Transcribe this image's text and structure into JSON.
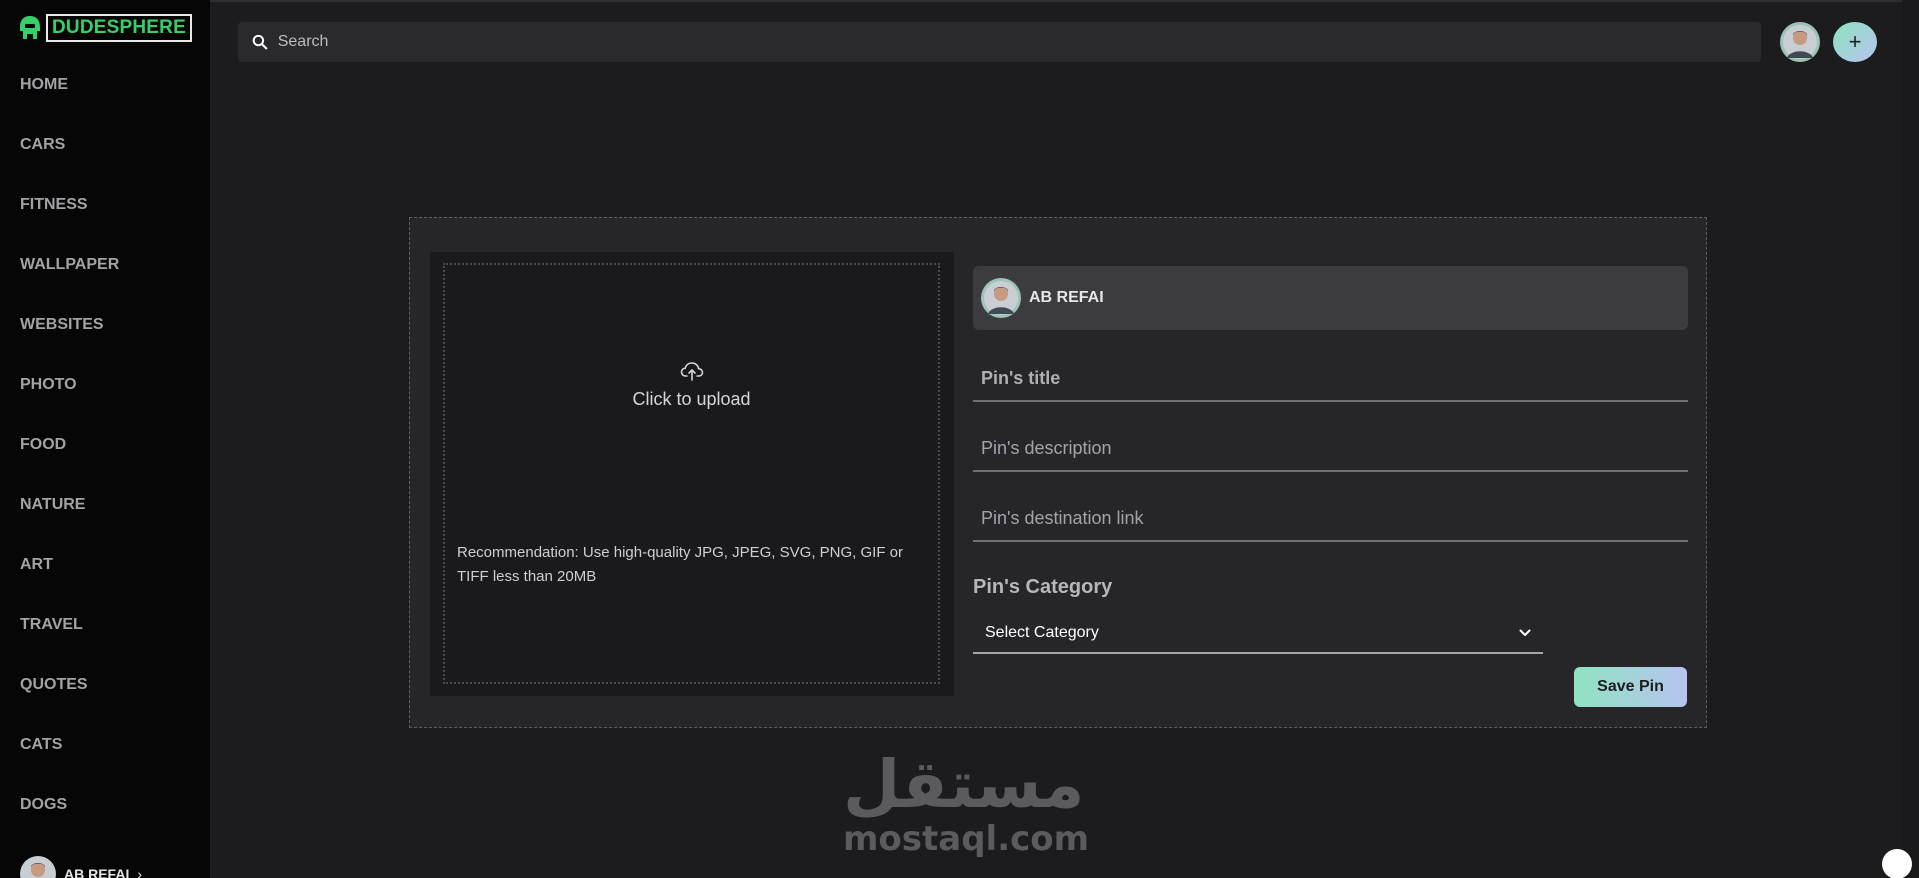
{
  "brand": {
    "name": "DUDESPHERE",
    "logo_icon": "helmet-icon",
    "accent": "#35d06a"
  },
  "sidebar": {
    "items": [
      {
        "label": "HOME"
      },
      {
        "label": "CARS"
      },
      {
        "label": "FITNESS"
      },
      {
        "label": "WALLPAPER"
      },
      {
        "label": "WEBSITES"
      },
      {
        "label": "PHOTO"
      },
      {
        "label": "FOOD"
      },
      {
        "label": "NATURE"
      },
      {
        "label": "ART"
      },
      {
        "label": "TRAVEL"
      },
      {
        "label": "QUOTES"
      },
      {
        "label": "CATS"
      },
      {
        "label": "DOGS"
      }
    ],
    "user": {
      "name": "AB REFAI",
      "chevron": "›"
    }
  },
  "header": {
    "search_placeholder": "Search",
    "add_label": "+"
  },
  "upload": {
    "label": "Click to upload",
    "hint": "Recommendation: Use high-quality JPG, JPEG, SVG, PNG, GIF or TIFF less than 20MB"
  },
  "form": {
    "owner_name": "AB REFAI",
    "title_placeholder": "Pin's title",
    "description_placeholder": "Pin's description",
    "link_placeholder": "Pin's destination link",
    "category_label": "Pin's Category",
    "category_value": "Select Category",
    "save_label": "Save Pin"
  },
  "watermark": {
    "arabic": "مستقل",
    "latin": "mostaql.com"
  },
  "colors": {
    "sidebar_bg": "#060607",
    "main_bg": "#1c1c1e",
    "card_bg": "#26262a",
    "button_gradient_start": "#8fe3c2",
    "button_gradient_end": "#b8c3ef"
  }
}
